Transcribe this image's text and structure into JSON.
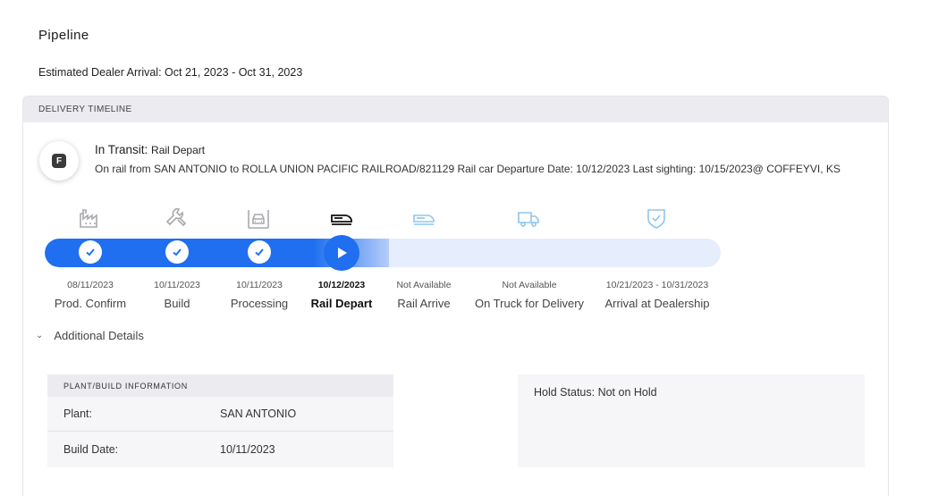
{
  "page": {
    "title": "Pipeline",
    "eta_label": "Estimated Dealer Arrival: Oct 21, 2023 - Oct 31, 2023"
  },
  "timeline": {
    "header": "DELIVERY TIMELINE",
    "badge_letter": "F",
    "status_main": "In Transit:",
    "status_sub": "Rail Depart",
    "status_desc": "On rail from SAN ANTONIO to ROLLA UNION PACIFIC RAILROAD/821129 Rail car Departure Date: 10/12/2023 Last sighting: 10/15/2023@ COFFEYVI, KS",
    "steps": [
      {
        "date": "08/11/2023",
        "label": "Prod. Confirm",
        "icon": "factory-icon",
        "state": "done"
      },
      {
        "date": "10/11/2023",
        "label": "Build",
        "icon": "wrench-icon",
        "state": "done"
      },
      {
        "date": "10/11/2023",
        "label": "Processing",
        "icon": "car-processing-icon",
        "state": "done"
      },
      {
        "date": "10/12/2023",
        "label": "Rail Depart",
        "icon": "train-icon",
        "state": "current"
      },
      {
        "date": "Not Available",
        "label": "Rail Arrive",
        "icon": "train-arrive-icon",
        "state": "pending"
      },
      {
        "date": "Not Available",
        "label": "On Truck for Delivery",
        "icon": "truck-icon",
        "state": "pending"
      },
      {
        "date": "10/21/2023 - 10/31/2023",
        "label": "Arrival at Dealership",
        "icon": "shield-check-icon",
        "state": "pending"
      }
    ]
  },
  "details": {
    "toggle_label": "Additional Details",
    "plant_header": "PLANT/BUILD INFORMATION",
    "plant_label": "Plant:",
    "plant_value": "SAN ANTONIO",
    "build_date_label": "Build Date:",
    "build_date_value": "10/11/2023",
    "hold_status": "Hold Status: Not on Hold"
  },
  "colors": {
    "accent": "#1f6ff0",
    "track_bg": "#e6edfc",
    "icon_done": "#a9a9ad",
    "icon_pending": "#8ec5ee"
  }
}
